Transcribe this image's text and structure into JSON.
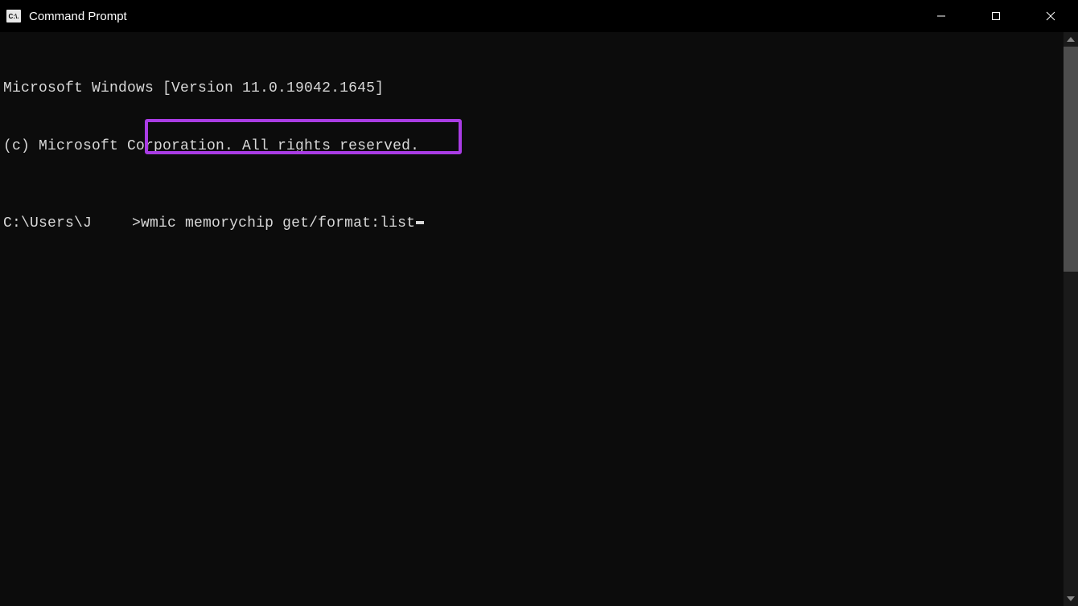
{
  "window": {
    "title": "Command Prompt",
    "icon_label": "C:\\."
  },
  "terminal": {
    "line1": "Microsoft Windows [Version 11.0.19042.1645]",
    "line2": "(c) Microsoft Corporation. All rights reserved.",
    "prompt_path": "C:\\Users\\J",
    "prompt_suffix": ">",
    "command": "wmic memorychip get/format:list"
  },
  "highlight": {
    "color": "#a93ce4"
  }
}
